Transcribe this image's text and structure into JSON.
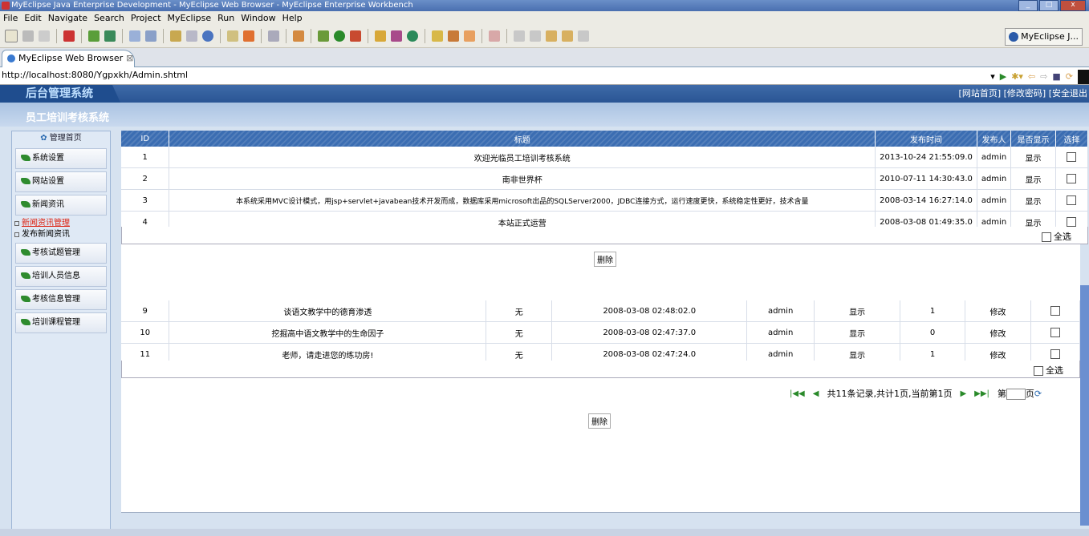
{
  "window": {
    "title": "MyEclipse Java Enterprise Development - MyEclipse Web Browser - MyEclipse Enterprise Workbench"
  },
  "menu": [
    "File",
    "Edit",
    "Navigate",
    "Search",
    "Project",
    "MyEclipse",
    "Run",
    "Window",
    "Help"
  ],
  "toolbar": {
    "perspective_label": "MyEclipse J..."
  },
  "browser": {
    "tab_label": "MyEclipse Web Browser",
    "tab_close": "⊠",
    "url": "http://localhost:8080/Ygpxkh/Admin.shtml"
  },
  "page": {
    "logo": "后台管理系统",
    "system_name": "员工培训考核系统",
    "top_links": "[网站首页] [修改密码] [安全退出",
    "sidebar_title": "管理首页",
    "sidebar": [
      {
        "label": "系统设置",
        "type": "btn"
      },
      {
        "label": "网站设置",
        "type": "btn"
      },
      {
        "label": "新闻资讯",
        "type": "btn"
      },
      {
        "label": "新闻资讯管理",
        "type": "sub",
        "active": true
      },
      {
        "label": "发布新闻资讯",
        "type": "sub"
      },
      {
        "label": "考核试题管理",
        "type": "btn"
      },
      {
        "label": "培训人员信息",
        "type": "btn"
      },
      {
        "label": "考核信息管理",
        "type": "btn"
      },
      {
        "label": "培训课程管理",
        "type": "btn"
      }
    ],
    "news_table": {
      "headers": [
        "ID",
        "标题",
        "发布时间",
        "发布人",
        "是否显示",
        "选择"
      ],
      "rows": [
        {
          "id": "1",
          "title": "欢迎光临员工培训考核系统",
          "time": "2013-10-24 21:55:09.0",
          "author": "admin",
          "show": "显示"
        },
        {
          "id": "2",
          "title": "南非世界杯",
          "time": "2010-07-11 14:30:43.0",
          "author": "admin",
          "show": "显示"
        },
        {
          "id": "3",
          "title": "本系统采用MVC设计模式，用jsp+servlet+javabean技术开发而成，数据库采用microsoft出品的SQLServer2000，JDBC连接方式，运行速度更快，系统稳定性更好，技术含量",
          "time": "2008-03-14 16:27:14.0",
          "author": "admin",
          "show": "显示"
        },
        {
          "id": "4",
          "title": "本站正式运营",
          "time": "2008-03-08 01:49:35.0",
          "author": "admin",
          "show": "显示"
        }
      ],
      "select_all": "全选",
      "delete": "删除"
    },
    "article_table": {
      "rows": [
        {
          "id": "9",
          "title": "谈语文教学中的德育渗透",
          "cat": "无",
          "time": "2008-03-08 02:48:02.0",
          "author": "admin",
          "show": "显示",
          "count": "1",
          "action": "修改"
        },
        {
          "id": "10",
          "title": "挖掘高中语文教学中的生命因子",
          "cat": "无",
          "time": "2008-03-08 02:47:37.0",
          "author": "admin",
          "show": "显示",
          "count": "0",
          "action": "修改"
        },
        {
          "id": "11",
          "title": "老师，请走进您的练功房!",
          "cat": "无",
          "time": "2008-03-08 02:47:24.0",
          "author": "admin",
          "show": "显示",
          "count": "1",
          "action": "修改"
        }
      ],
      "select_all": "全选",
      "delete": "删除"
    },
    "pager": {
      "summary": "共11条记录,共计1页,当前第1页",
      "page_prefix": "第",
      "page_suffix": "页"
    }
  }
}
